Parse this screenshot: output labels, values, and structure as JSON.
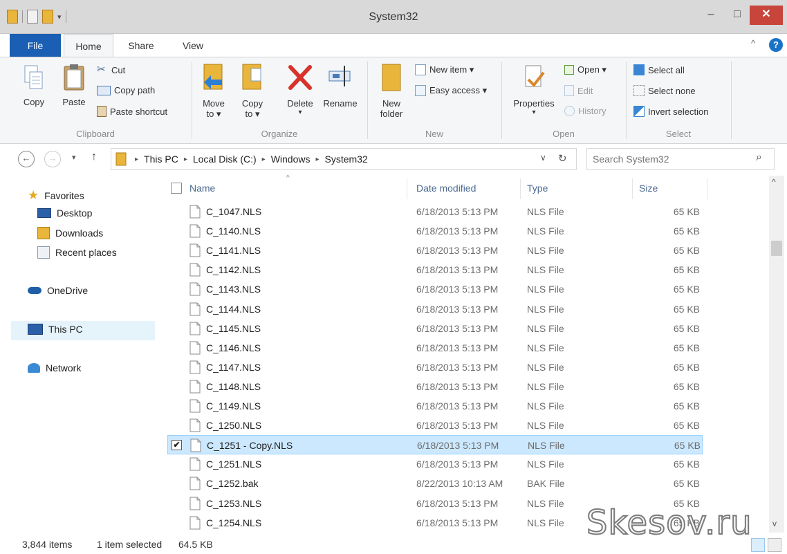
{
  "window": {
    "title": "System32",
    "min_glyph": "–",
    "max_glyph": "□",
    "close_glyph": "✕"
  },
  "ribbon_tabs": {
    "file": "File",
    "home": "Home",
    "share": "Share",
    "view": "View",
    "collapse_glyph": "^",
    "help_glyph": "?"
  },
  "ribbon": {
    "clipboard": {
      "label": "Clipboard",
      "copy": "Copy",
      "paste": "Paste",
      "cut": "Cut",
      "copy_path": "Copy path",
      "paste_shortcut": "Paste shortcut"
    },
    "organize": {
      "label": "Organize",
      "move_to": "Move",
      "move_to_2": "to ▾",
      "copy_to": "Copy",
      "copy_to_2": "to ▾",
      "delete": "Delete",
      "delete_2": "▾",
      "rename": "Rename"
    },
    "new": {
      "label": "New",
      "new_folder": "New",
      "new_folder_2": "folder",
      "new_item": "New item ▾",
      "easy_access": "Easy access ▾"
    },
    "open": {
      "label": "Open",
      "properties": "Properties",
      "properties_2": "▾",
      "open": "Open ▾",
      "edit": "Edit",
      "history": "History"
    },
    "select": {
      "label": "Select",
      "select_all": "Select all",
      "select_none": "Select none",
      "invert_selection": "Invert selection"
    }
  },
  "address_bar": {
    "back_glyph": "←",
    "forward_glyph": "→",
    "recent_glyph": "▾",
    "up_glyph": "↑",
    "crumbs": [
      "This PC",
      "Local Disk (C:)",
      "Windows",
      "System32"
    ],
    "crumb_sep": "▸",
    "dropdown_glyph": "∨",
    "refresh_glyph": "↻",
    "search_placeholder": "Search System32",
    "search_glyph": "⌕"
  },
  "nav_pane": {
    "favorites": "Favorites",
    "desktop": "Desktop",
    "downloads": "Downloads",
    "recent_places": "Recent places",
    "onedrive": "OneDrive",
    "this_pc": "This PC",
    "network": "Network"
  },
  "file_list": {
    "columns": {
      "name": "Name",
      "date_modified": "Date modified",
      "type": "Type",
      "size": "Size",
      "sort_glyph": "^"
    },
    "rows": [
      {
        "name": "C_1047.NLS",
        "date": "6/18/2013 5:13 PM",
        "type": "NLS File",
        "size": "65 KB"
      },
      {
        "name": "C_1140.NLS",
        "date": "6/18/2013 5:13 PM",
        "type": "NLS File",
        "size": "65 KB"
      },
      {
        "name": "C_1141.NLS",
        "date": "6/18/2013 5:13 PM",
        "type": "NLS File",
        "size": "65 KB"
      },
      {
        "name": "C_1142.NLS",
        "date": "6/18/2013 5:13 PM",
        "type": "NLS File",
        "size": "65 KB"
      },
      {
        "name": "C_1143.NLS",
        "date": "6/18/2013 5:13 PM",
        "type": "NLS File",
        "size": "65 KB"
      },
      {
        "name": "C_1144.NLS",
        "date": "6/18/2013 5:13 PM",
        "type": "NLS File",
        "size": "65 KB"
      },
      {
        "name": "C_1145.NLS",
        "date": "6/18/2013 5:13 PM",
        "type": "NLS File",
        "size": "65 KB"
      },
      {
        "name": "C_1146.NLS",
        "date": "6/18/2013 5:13 PM",
        "type": "NLS File",
        "size": "65 KB"
      },
      {
        "name": "C_1147.NLS",
        "date": "6/18/2013 5:13 PM",
        "type": "NLS File",
        "size": "65 KB"
      },
      {
        "name": "C_1148.NLS",
        "date": "6/18/2013 5:13 PM",
        "type": "NLS File",
        "size": "65 KB"
      },
      {
        "name": "C_1149.NLS",
        "date": "6/18/2013 5:13 PM",
        "type": "NLS File",
        "size": "65 KB"
      },
      {
        "name": "C_1250.NLS",
        "date": "6/18/2013 5:13 PM",
        "type": "NLS File",
        "size": "65 KB"
      },
      {
        "name": "C_1251 - Copy.NLS",
        "date": "6/18/2013 5:13 PM",
        "type": "NLS File",
        "size": "65 KB",
        "selected": true,
        "check_glyph": "✔"
      },
      {
        "name": "C_1251.NLS",
        "date": "6/18/2013 5:13 PM",
        "type": "NLS File",
        "size": "65 KB"
      },
      {
        "name": "C_1252.bak",
        "date": "8/22/2013 10:13 AM",
        "type": "BAK File",
        "size": "65 KB"
      },
      {
        "name": "C_1253.NLS",
        "date": "6/18/2013 5:13 PM",
        "type": "NLS File",
        "size": "65 KB"
      },
      {
        "name": "C_1254.NLS",
        "date": "6/18/2013 5:13 PM",
        "type": "NLS File",
        "size": "65 KB"
      }
    ]
  },
  "scrollbar": {
    "up_glyph": "^",
    "down_glyph": "v"
  },
  "status_bar": {
    "item_count": "3,844 items",
    "selection": "1 item selected",
    "selection_size": "64.5 KB"
  },
  "watermark": "Skesov.ru",
  "colors": {
    "file_tab": "#1a5fb4",
    "close_button": "#c7453b",
    "selection_fill": "#cce8ff",
    "selection_border": "#99d1ff",
    "column_header": "#4c6a91",
    "folder": "#e9b53a"
  }
}
